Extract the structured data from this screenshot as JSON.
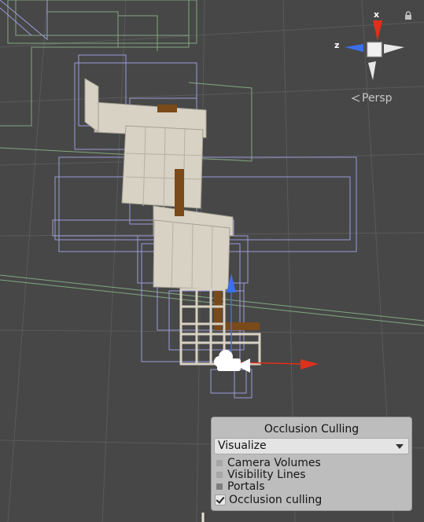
{
  "scene_view": {
    "projection_label": "Persp",
    "gizmo": {
      "x_axis": "x",
      "z_axis": "z"
    }
  },
  "occlusion_panel": {
    "title": "Occlusion Culling",
    "mode": "Visualize",
    "legend": [
      {
        "label": "Camera Volumes",
        "color": "#aaaaaa"
      },
      {
        "label": "Visibility Lines",
        "color": "#aaaaaa"
      },
      {
        "label": "Portals",
        "color": "#808080"
      }
    ],
    "occlusion_culling_label": "Occlusion culling",
    "occlusion_culling_checked": true
  }
}
